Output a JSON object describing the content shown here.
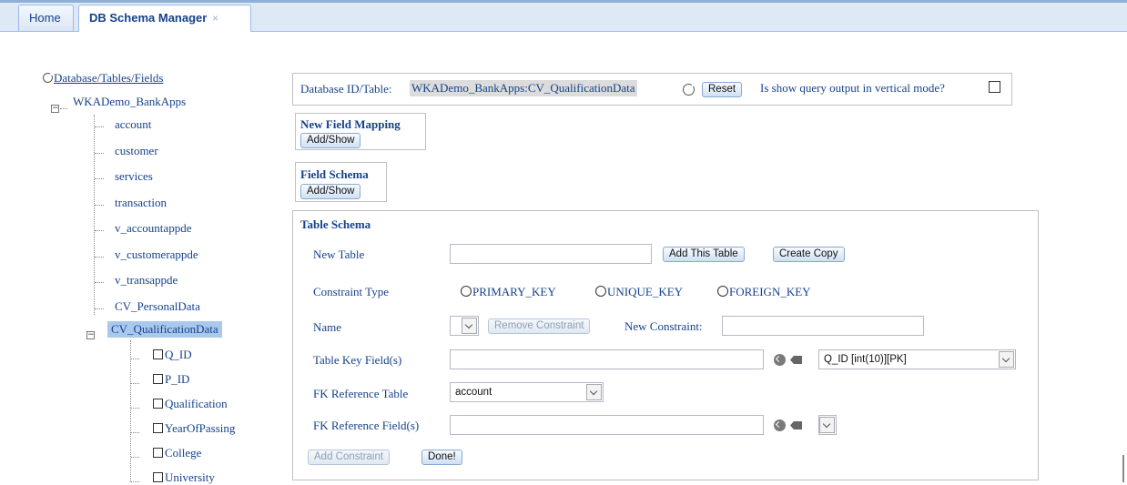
{
  "tabs": {
    "home": "Home",
    "active": "DB Schema Manager",
    "close_glyph": "×"
  },
  "tree": {
    "root_label": "Database/Tables/Fields",
    "database": "WKADemo_BankApps",
    "tables": [
      "account",
      "customer",
      "services",
      "transaction",
      "v_accountappde",
      "v_customerappde",
      "v_transappde",
      "CV_PersonalData"
    ],
    "selected_table": "CV_QualificationData",
    "fields": [
      "Q_ID",
      "P_ID",
      "Qualification",
      "YearOfPassing",
      "College",
      "University"
    ]
  },
  "db_bar": {
    "label": "Database ID/Table:",
    "value": "WKADemo_BankApps:CV_QualificationData",
    "reset": "Reset",
    "vertical_label": "Is show query output in vertical mode?"
  },
  "new_field_mapping": {
    "title": "New Field Mapping",
    "button": "Add/Show"
  },
  "field_schema": {
    "title": "Field Schema",
    "button": "Add/Show"
  },
  "table_schema": {
    "title": "Table Schema",
    "new_table_label": "New Table",
    "add_table_btn": "Add This Table",
    "create_copy_btn": "Create Copy",
    "constraint_type_label": "Constraint Type",
    "radio_primary": "PRIMARY_KEY",
    "radio_unique": "UNIQUE_KEY",
    "radio_foreign": "FOREIGN_KEY",
    "name_label": "Name",
    "remove_constraint_btn": "Remove Constraint",
    "new_constraint_label": "New Constraint:",
    "key_fields_label": "Table Key Field(s)",
    "key_field_select": "Q_ID [int(10)][PK]",
    "fk_table_label": "FK Reference Table",
    "fk_table_select": "account",
    "fk_field_label": "FK Reference Field(s)",
    "add_constraint_btn": "Add Constraint",
    "done_btn": "Done!"
  }
}
